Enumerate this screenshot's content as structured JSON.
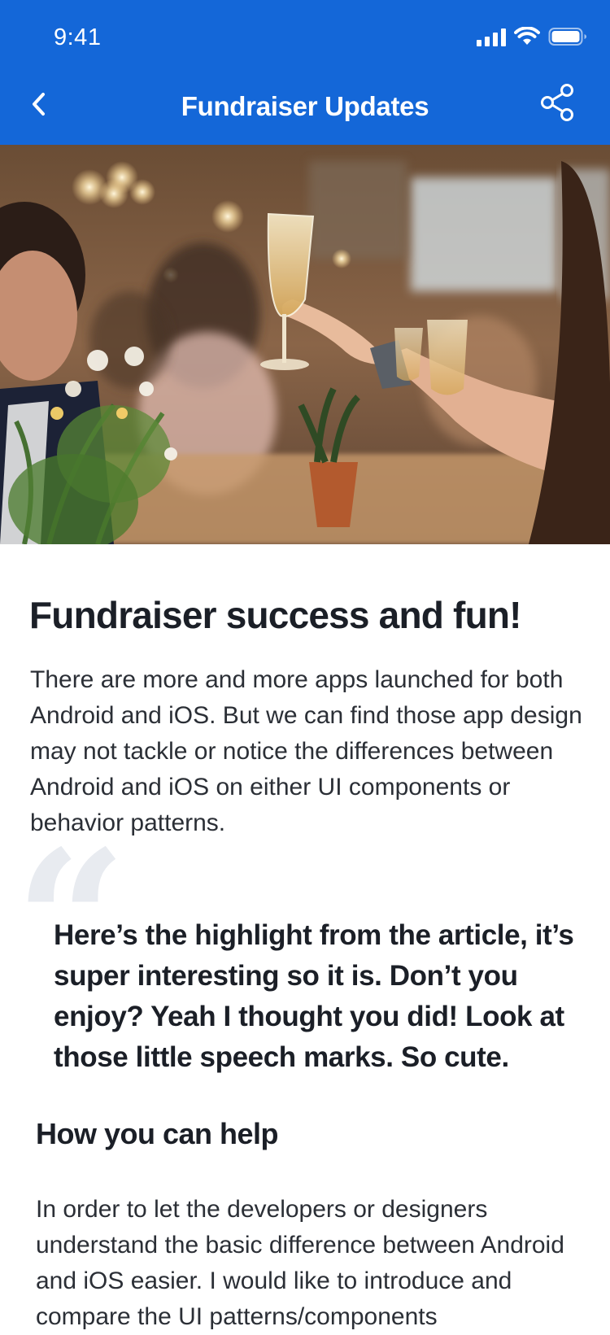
{
  "status_bar": {
    "time": "9:41"
  },
  "nav": {
    "title": "Fundraiser Updates",
    "back_icon": "chevron-left-icon",
    "share_icon": "share-icon"
  },
  "hero_image": {
    "subject": "people raising champagne glasses in a toast"
  },
  "article": {
    "title": "Fundraiser success and fun!",
    "intro": "There are more and more apps launched for both Android and iOS. But we can find those app design may not tackle or notice the differences between Android and iOS on either UI components or behavior patterns.",
    "quote_mark": "“",
    "pull_quote": "Here’s the highlight from the article, it’s super interesting so it is. Don’t you enjoy? Yeah I thought you did! Look at those little speech marks. So cute.",
    "section_heading": "How you can help",
    "section_body": "In order to let the developers or designers understand the basic difference between Android and iOS easier. I would like to introduce and compare the UI patterns/components"
  },
  "colors": {
    "header_background": "#1467d8",
    "text_primary": "#1b1f27",
    "quote_mark": "#e8ebf0"
  }
}
